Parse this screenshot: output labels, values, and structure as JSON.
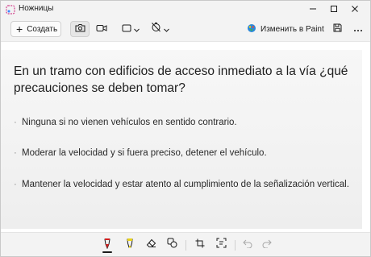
{
  "window": {
    "title": "Ножницы"
  },
  "toolbar": {
    "new_label": "Создать",
    "paint_label": "Изменить в Paint",
    "modes": [
      "camera-icon",
      "video-icon"
    ],
    "selected_mode": "camera-icon"
  },
  "snip": {
    "question": "En un tramo con edificios de acceso inmediato a la vía ¿qué precauciones se deben tomar?",
    "options": [
      "Ninguna si no vienen vehículos en sentido contrario.",
      "Moderar la velocidad y si fuera preciso, detener el vehículo.",
      "Mantener la velocidad y estar atento al cumplimiento de la señalización vertical."
    ]
  },
  "bottombar": {
    "tools": [
      "ballpoint-pen-icon",
      "highlighter-icon",
      "eraser-icon",
      "shapes-icon",
      "crop-icon",
      "text-actions-icon",
      "undo-icon",
      "redo-icon"
    ],
    "selected_tool": "ballpoint-pen-icon",
    "pen_color": "#d42020",
    "highlighter_color": "#e8d21a"
  }
}
